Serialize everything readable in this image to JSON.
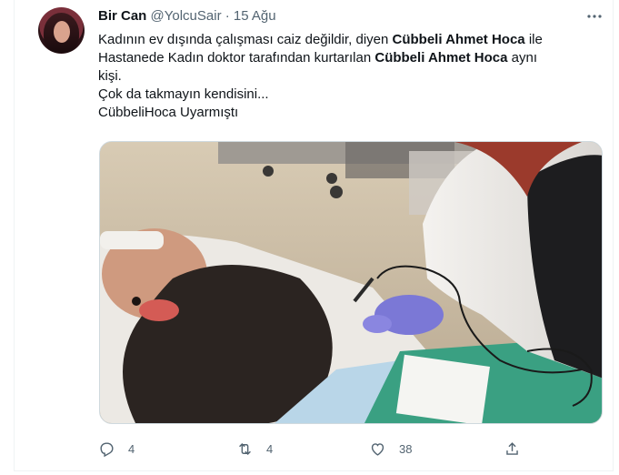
{
  "tweet": {
    "author_name": "Bir Can",
    "author_handle": "@YolcuSair",
    "separator": "·",
    "date": "15 Ağu",
    "more_icon": "more-horizontal-icon",
    "line1_a": "Kadının ev dışında çalışması caiz değildir, diyen ",
    "line1_bold": "Cübbeli Ahmet Hoca",
    "line1_b": " ile",
    "line2_a": "Hastanede Kadın doktor tarafından kurtarılan ",
    "line2_bold": "Cübbeli Ahmet Hoca",
    "line2_b": " aynı",
    "line3": "kişi.",
    "line4": "Çok da takmayın kendisini...",
    "line5": "CübbeliHoca Uyarmıştı"
  },
  "actions": {
    "reply": {
      "icon": "reply-icon",
      "count": "4"
    },
    "retweet": {
      "icon": "retweet-icon",
      "count": "4"
    },
    "like": {
      "icon": "heart-icon",
      "count": "38"
    },
    "share": {
      "icon": "share-icon"
    }
  },
  "colors": {
    "text": "#0f1419",
    "secondary": "#536471",
    "border": "#cfd9de"
  }
}
